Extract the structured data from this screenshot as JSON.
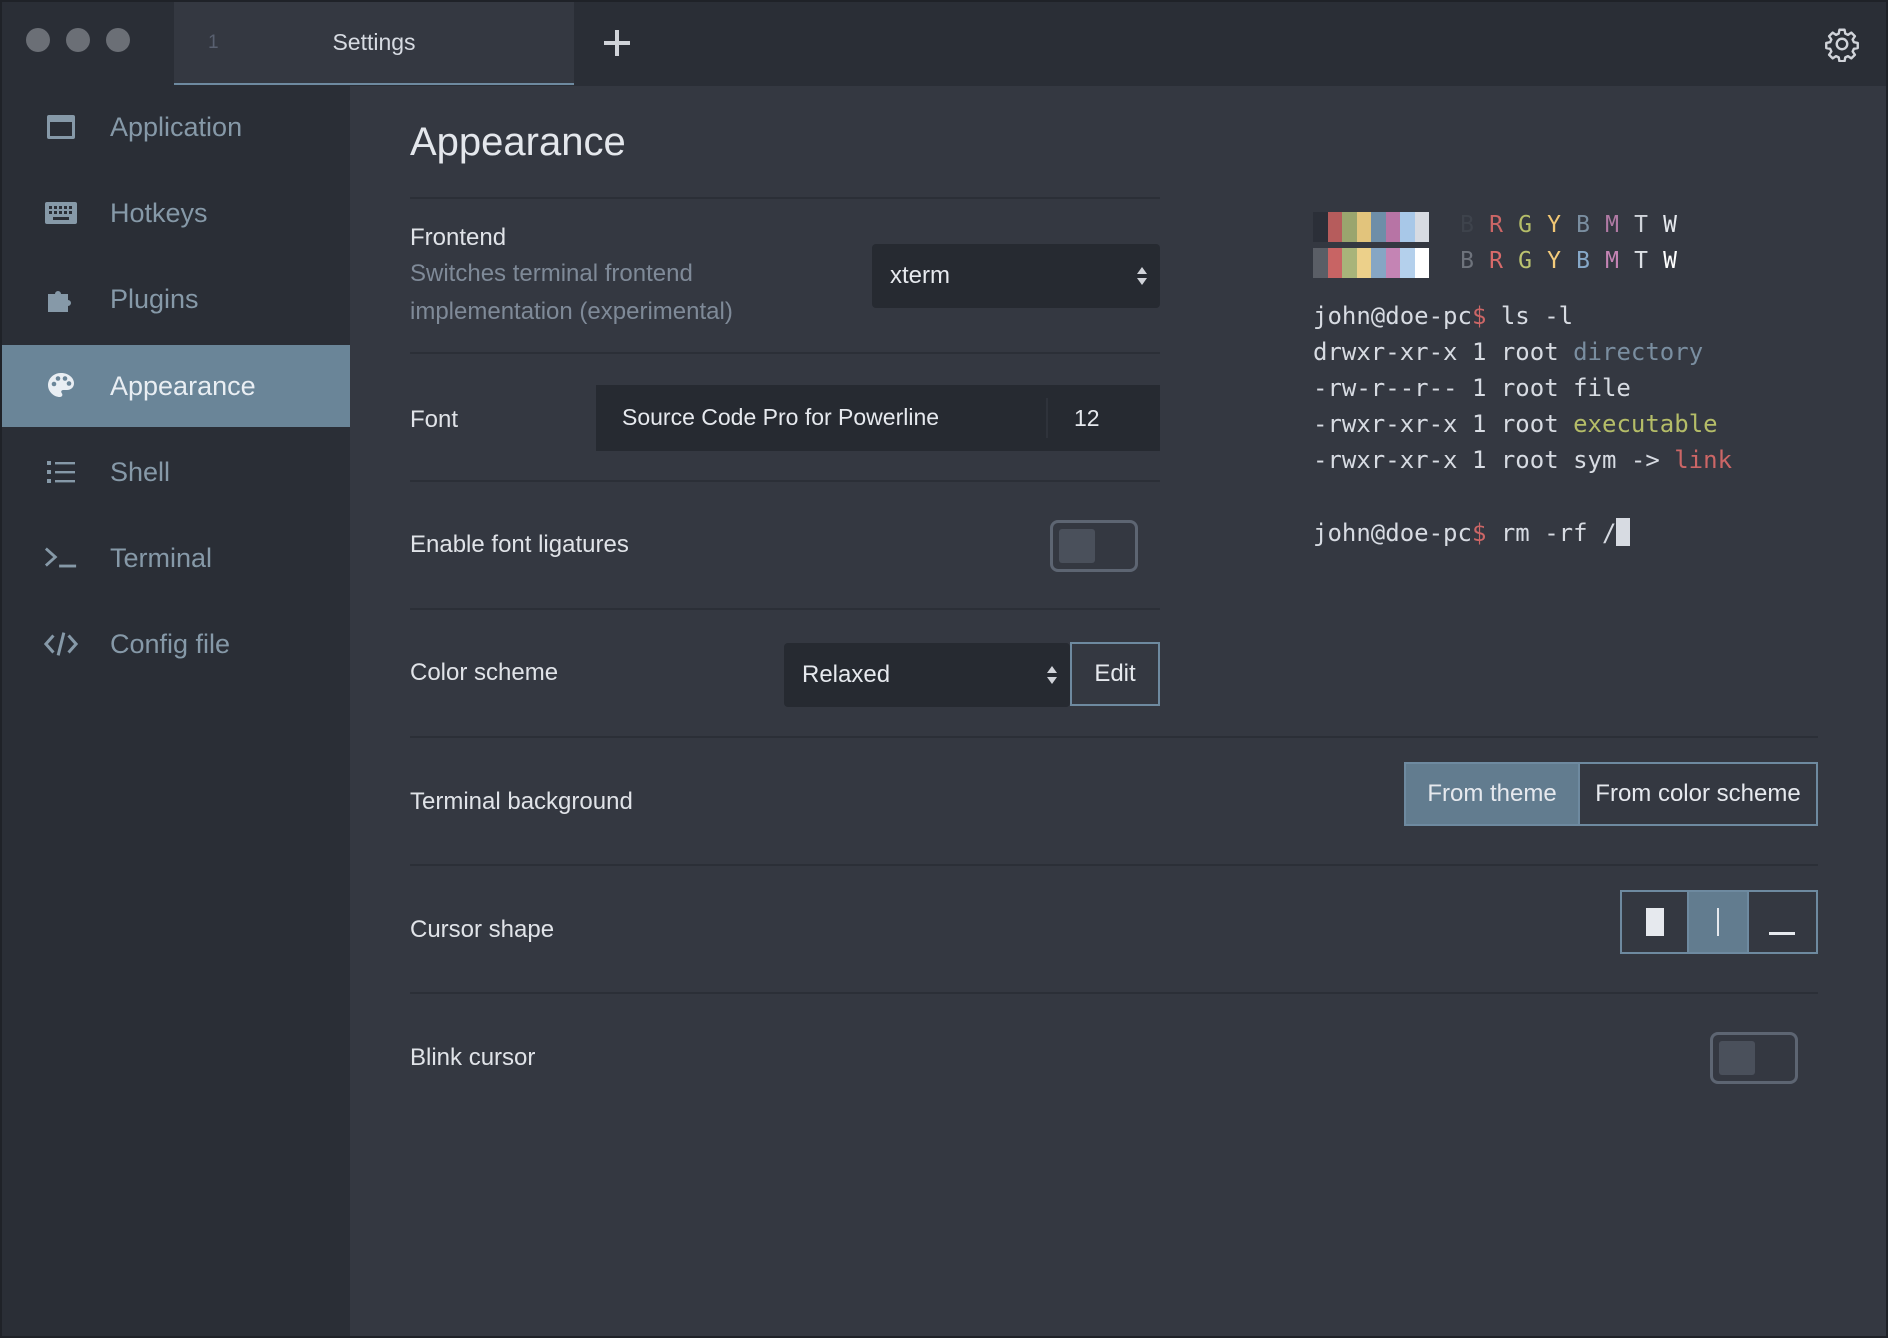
{
  "titlebar": {
    "tab_index": "1",
    "tab_title": "Settings"
  },
  "sidebar": {
    "items": [
      {
        "label": "Application",
        "icon": "window-icon"
      },
      {
        "label": "Hotkeys",
        "icon": "keyboard-icon"
      },
      {
        "label": "Plugins",
        "icon": "puzzle-icon"
      },
      {
        "label": "Appearance",
        "icon": "palette-icon",
        "active": true
      },
      {
        "label": "Shell",
        "icon": "list-icon"
      },
      {
        "label": "Terminal",
        "icon": "terminal-prompt-icon"
      },
      {
        "label": "Config file",
        "icon": "code-icon"
      }
    ]
  },
  "main": {
    "title": "Appearance",
    "frontend": {
      "label": "Frontend",
      "desc1": "Switches terminal frontend",
      "desc2": "implementation (experimental)",
      "value": "xterm"
    },
    "font": {
      "label": "Font",
      "name": "Source Code Pro for Powerline",
      "size": "12"
    },
    "ligatures": {
      "label": "Enable font ligatures",
      "enabled": false
    },
    "color_scheme": {
      "label": "Color scheme",
      "value": "Relaxed",
      "edit_label": "Edit"
    },
    "terminal_background": {
      "label": "Terminal background",
      "options": [
        "From theme",
        "From color scheme"
      ],
      "selected": "From theme"
    },
    "cursor_shape": {
      "label": "Cursor shape",
      "options": [
        "block",
        "beam",
        "underline"
      ],
      "selected": "beam"
    },
    "blink_cursor": {
      "label": "Blink cursor",
      "enabled": false
    }
  },
  "preview": {
    "palette_normal": [
      "#2b2f38",
      "#b65c5c",
      "#9aa56e",
      "#e2c47c",
      "#6e8ea8",
      "#b774a5",
      "#a8c8e8",
      "#d7dbe2"
    ],
    "palette_bright": [
      "#5a5e66",
      "#c86464",
      "#a8b47a",
      "#ecd08a",
      "#86a6c4",
      "#c484b4",
      "#b4d0ec",
      "#ffffff"
    ],
    "letters": [
      "B",
      "R",
      "G",
      "Y",
      "B",
      "M",
      "T",
      "W"
    ],
    "letter_colors_normal": [
      "#3e434c",
      "#cc6666",
      "#b5bd68",
      "#f0c674",
      "#7a8ea0",
      "#b07aa4",
      "#d0d4da",
      "#e6e9ee"
    ],
    "letter_colors_bright": [
      "#6e737c",
      "#d86a6a",
      "#bcc470",
      "#f4cc7c",
      "#86a8c8",
      "#c484b4",
      "#dde1e6",
      "#ffffff"
    ],
    "prompt": "john@doe-pc",
    "dollar": "$",
    "cmd1": " ls -l",
    "line1_prefix": "drwxr-xr-x 1 root ",
    "line1_name": "directory",
    "line2": "-rw-r--r-- 1 root file",
    "line3_prefix": "-rwxr-xr-x 1 root ",
    "line3_name": "executable",
    "line4_prefix": "-rwxr-xr-x 1 root sym -> ",
    "line4_name": "link",
    "cmd2": " rm -rf /"
  }
}
